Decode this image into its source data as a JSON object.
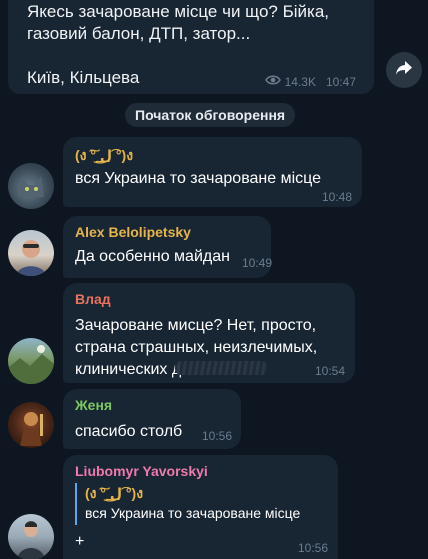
{
  "post": {
    "text": "Якесь зачароване місце чи що? Бійка,\nгазовий балон, ДТП, затор...\n\nКиїв, Кільцева",
    "views": "14.3K",
    "time": "10:47"
  },
  "service_label": "Початок обговорення",
  "comments": [
    {
      "author": "(ง ͠° ͟ل͜ ͡°)ง",
      "text": "вся Украина то зачароване місце",
      "time": "10:48",
      "author_color": "#e5b54c"
    },
    {
      "author": "Alex Belolipetsky",
      "text": "Да особенно майдан",
      "time": "10:49",
      "author_color": "#e5b54c"
    },
    {
      "author": "Влад",
      "text": "Зачароване мисце? Нет, просто,\nстрана страшных, неизлечимых,\nклинических д",
      "time": "10:54",
      "author_color": "#e8735f"
    },
    {
      "author": "Женя",
      "text": "спасибо столб",
      "time": "10:56",
      "author_color": "#7bc862"
    },
    {
      "author": "Liubomyr Yavorskyi",
      "quote_author": "(ง ͠° ͟ل͜ ͡°)ง",
      "quote_text": "вся Украина то зачароване місце",
      "text": "+",
      "time": "10:56",
      "author_color": "#ee7aae"
    }
  ]
}
